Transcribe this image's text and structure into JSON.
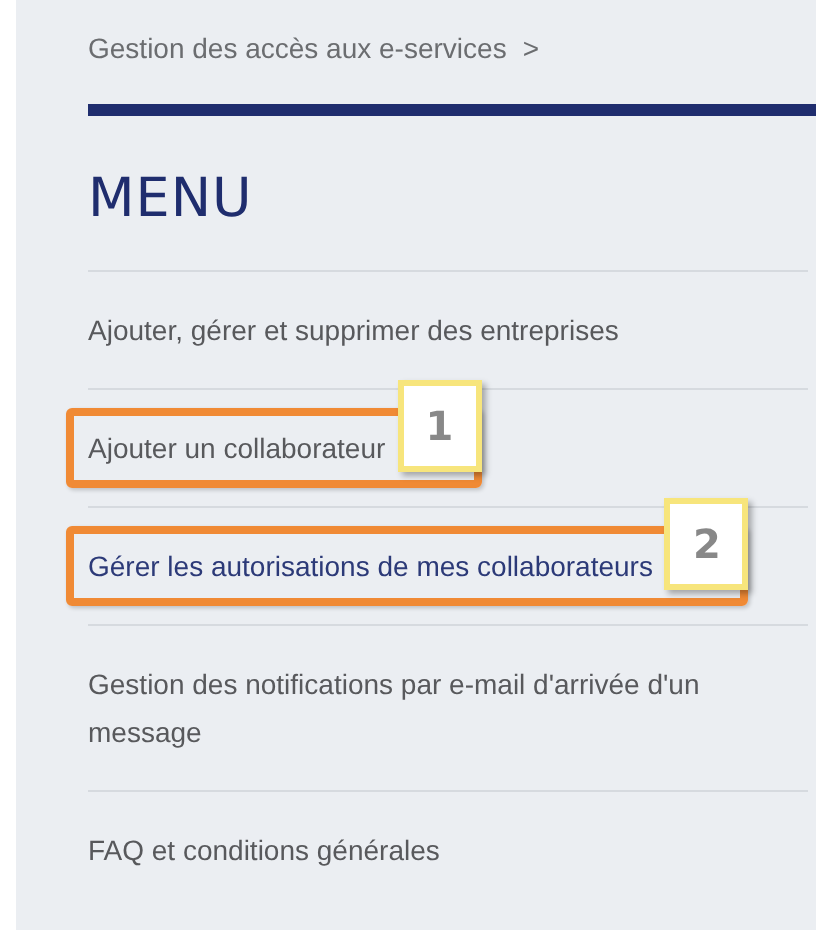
{
  "breadcrumb": {
    "label": "Gestion des accès aux e-services",
    "separator": ">"
  },
  "menu": {
    "title": "MENU",
    "items": [
      {
        "label": "Ajouter, gérer et supprimer des entreprises",
        "selected": false
      },
      {
        "label": "Ajouter un collaborateur",
        "selected": false,
        "callout": "1"
      },
      {
        "label": "Gérer les autorisations de mes collaborateurs",
        "selected": true,
        "callout": "2"
      },
      {
        "label": "Gestion des notifications par e-mail d'arrivée d'un message",
        "selected": false
      },
      {
        "label": "FAQ et conditions générales",
        "selected": false
      }
    ]
  }
}
